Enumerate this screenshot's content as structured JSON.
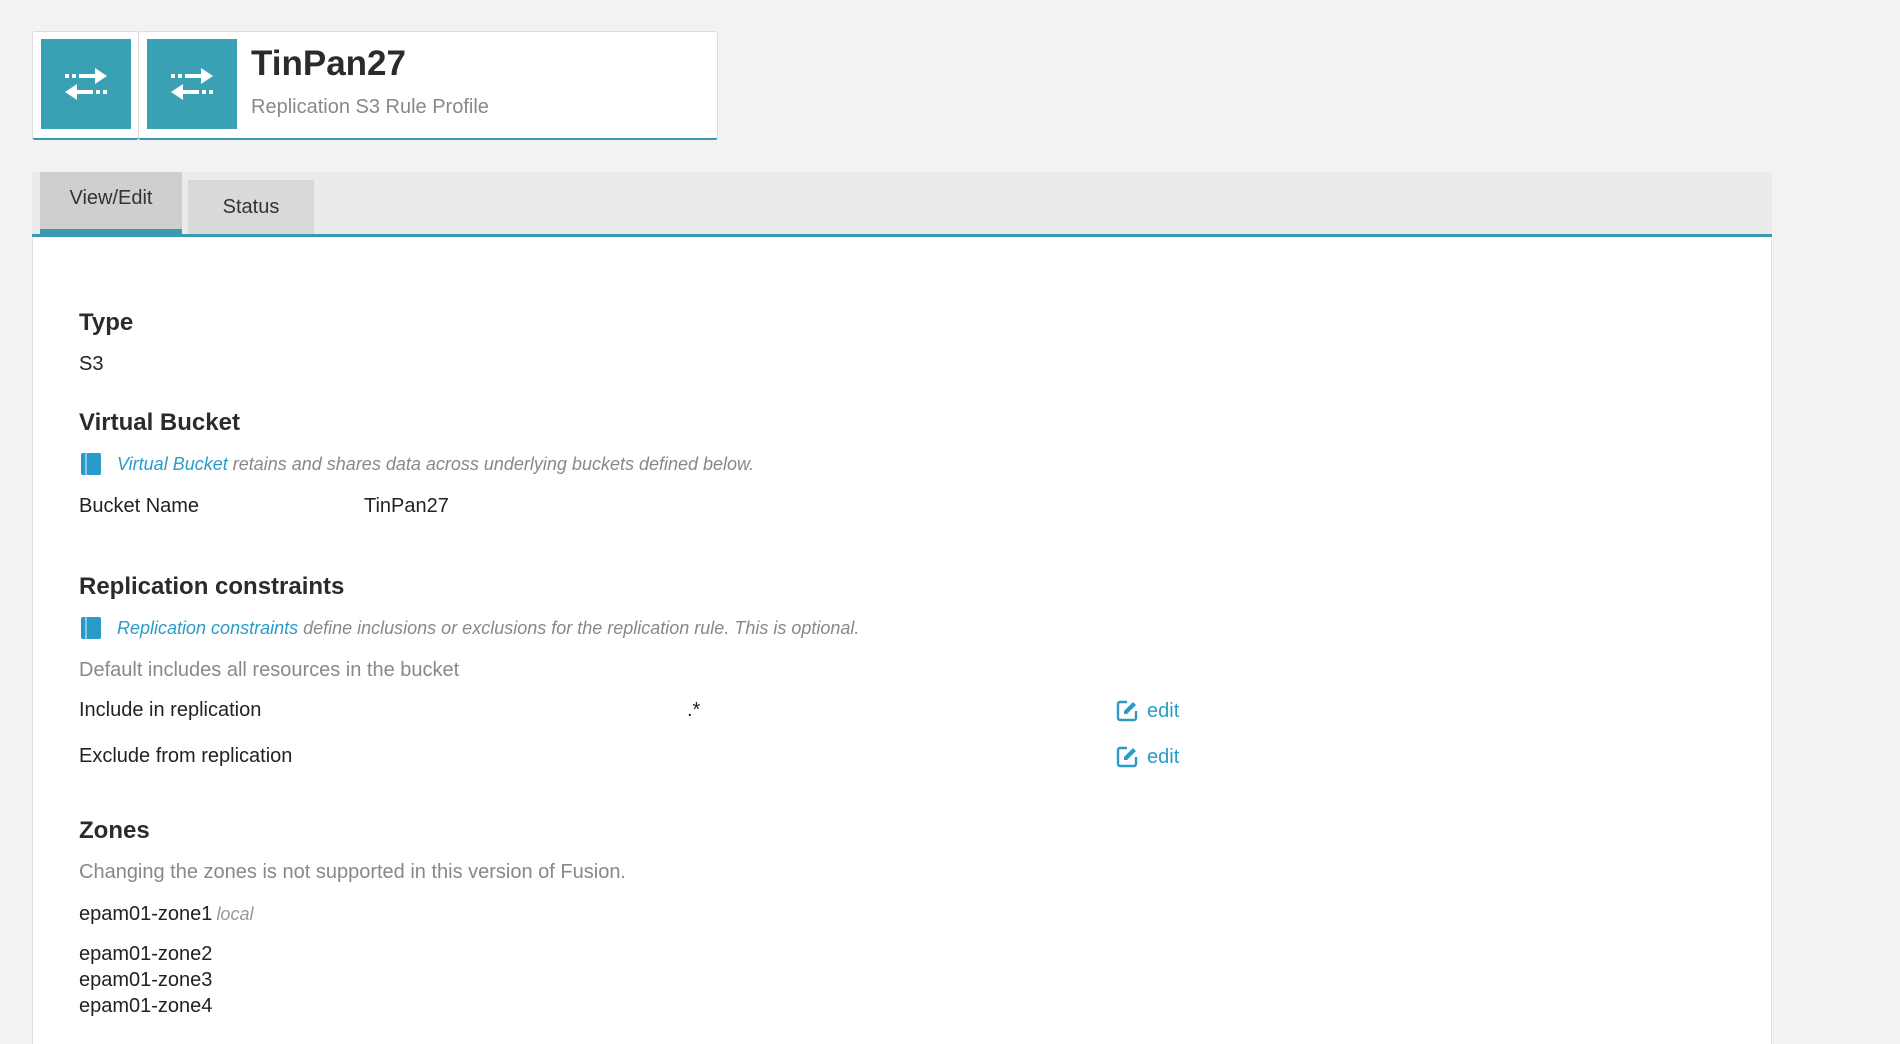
{
  "header": {
    "title": "TinPan27",
    "subtitle": "Replication S3 Rule Profile",
    "icon": "replication-arrows-icon",
    "accent_color": "#3aa0b3"
  },
  "tabs": [
    {
      "label": "View/Edit",
      "active": true
    },
    {
      "label": "Status",
      "active": false
    }
  ],
  "type_section": {
    "heading": "Type",
    "value": "S3"
  },
  "virtual_bucket": {
    "heading": "Virtual Bucket",
    "note_link": "Virtual Bucket",
    "note_text": "retains and shares data across underlying buckets defined below.",
    "bucket_name_label": "Bucket Name",
    "bucket_name_value": "TinPan27"
  },
  "replication_constraints": {
    "heading": "Replication constraints",
    "note_link": "Replication constraints",
    "note_text": "define inclusions or exclusions for the replication rule. This is optional.",
    "default_text": "Default includes all resources in the bucket",
    "include_label": "Include in replication",
    "include_value": ".*",
    "exclude_label": "Exclude from replication",
    "exclude_value": "",
    "edit_label": "edit"
  },
  "zones": {
    "heading": "Zones",
    "note": "Changing the zones is not supported in this version of Fusion.",
    "local_zone": "epam01-zone1",
    "local_tag": "local",
    "others": [
      "epam01-zone2",
      "epam01-zone3",
      "epam01-zone4"
    ]
  }
}
